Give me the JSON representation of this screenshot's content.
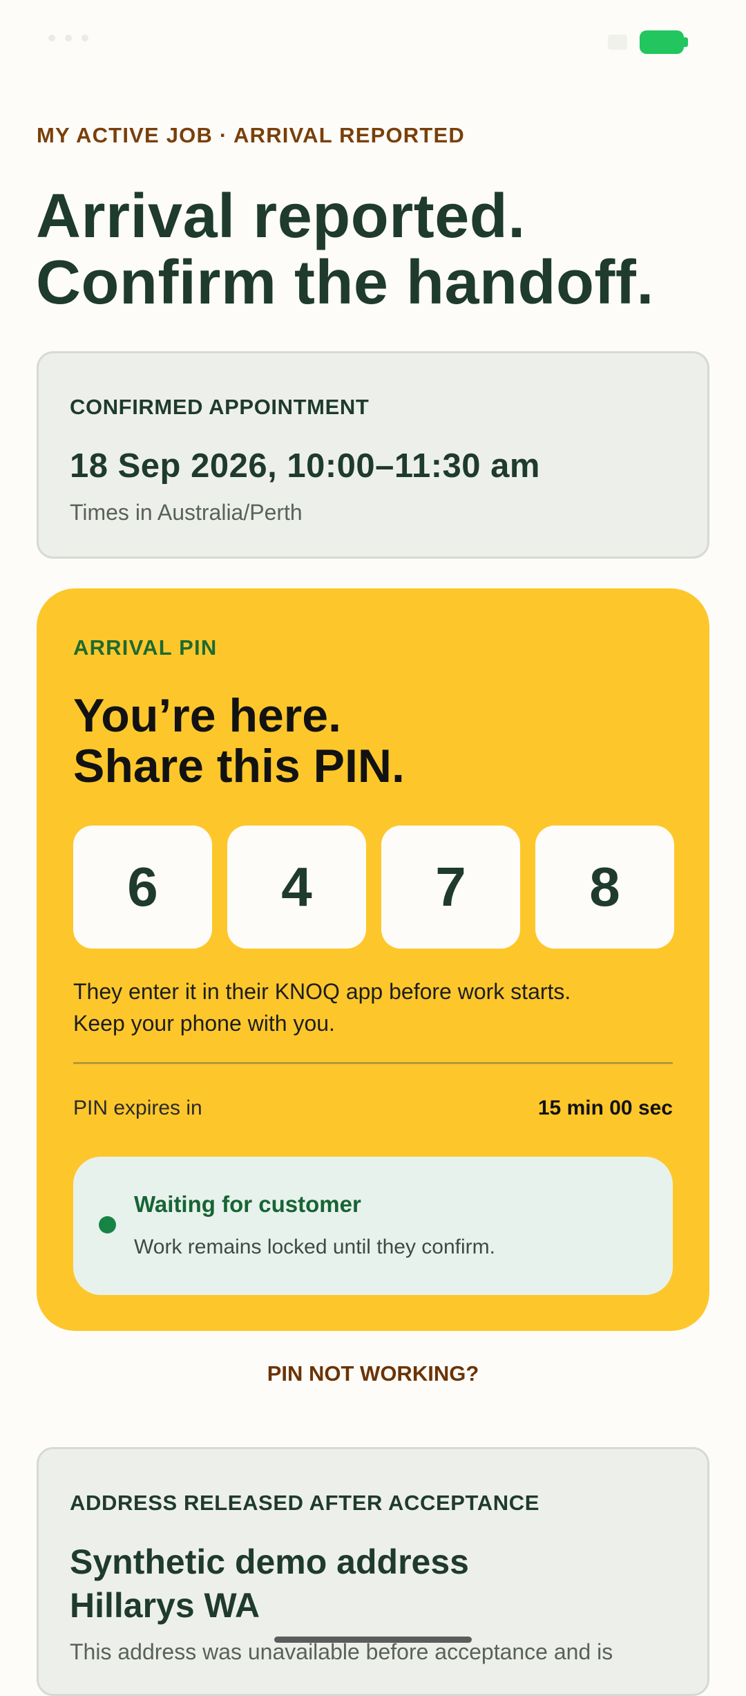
{
  "status_bar": {
    "battery_color": "#22c55e"
  },
  "header": {
    "eyebrow": "MY ACTIVE JOB · ARRIVAL REPORTED",
    "headline_line1": "Arrival reported.",
    "headline_line2": "Confirm the handoff."
  },
  "appointment": {
    "label": "CONFIRMED APPOINTMENT",
    "time": "18 Sep 2026, 10:00–11:30 am",
    "timezone": "Times in Australia/Perth"
  },
  "pin_card": {
    "label": "ARRIVAL PIN",
    "title_line1": "You’re here.",
    "title_line2": "Share this PIN.",
    "digits": [
      "6",
      "4",
      "7",
      "8"
    ],
    "help_line1": "They enter it in their KNOQ app before work starts.",
    "help_line2": "Keep your phone with you.",
    "expires_label": "PIN expires in",
    "expires_value": "15 min 00 sec",
    "status_title": "Waiting for customer",
    "status_subtitle": "Work remains locked until they confirm.",
    "background_color": "#fdc72b",
    "status_color": "#178345"
  },
  "pin_help_link": "PIN NOT WORKING?",
  "address": {
    "label": "ADDRESS RELEASED AFTER ACCEPTANCE",
    "title_line1": "Synthetic demo address",
    "title_line2": "Hillarys WA",
    "note": "This address was unavailable before acceptance and is"
  }
}
